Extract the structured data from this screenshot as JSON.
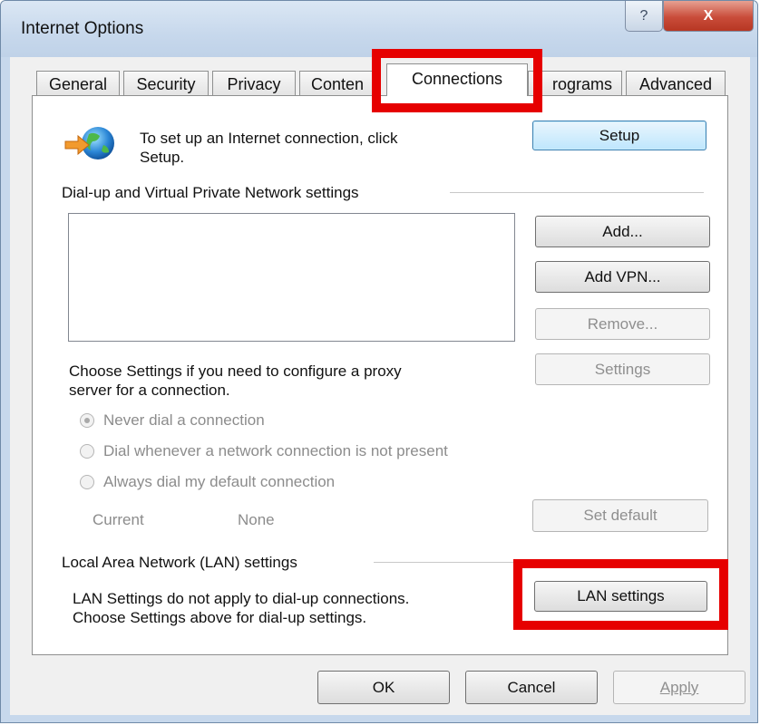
{
  "window": {
    "title": "Internet Options",
    "help_label": "?",
    "close_label": "X"
  },
  "tabs": [
    {
      "label": "General"
    },
    {
      "label": "Security"
    },
    {
      "label": "Privacy"
    },
    {
      "label": "Conten"
    },
    {
      "label": "Connections"
    },
    {
      "label": "rograms"
    },
    {
      "label": "Advanced"
    }
  ],
  "setup": {
    "text_line1": "To set up an Internet connection, click",
    "text_line2": "Setup.",
    "button": "Setup"
  },
  "dialup": {
    "heading": "Dial-up and Virtual Private Network settings",
    "add": "Add...",
    "add_vpn": "Add VPN...",
    "remove": "Remove...",
    "settings": "Settings",
    "proxy_line1": "Choose Settings if you need to configure a proxy",
    "proxy_line2": "server for a connection.",
    "radio_never": "Never dial a connection",
    "radio_whenever": "Dial whenever a network connection is not present",
    "radio_always": "Always dial my default connection",
    "current_label": "Current",
    "current_value": "None",
    "set_default": "Set default"
  },
  "lan": {
    "heading": "Local Area Network (LAN) settings",
    "text_line1": "LAN Settings do not apply to dial-up connections.",
    "text_line2": "Choose Settings above for dial-up settings.",
    "button": "LAN settings"
  },
  "footer": {
    "ok": "OK",
    "cancel": "Cancel",
    "apply": "Apply"
  },
  "colors": {
    "highlight": "#e60000"
  }
}
